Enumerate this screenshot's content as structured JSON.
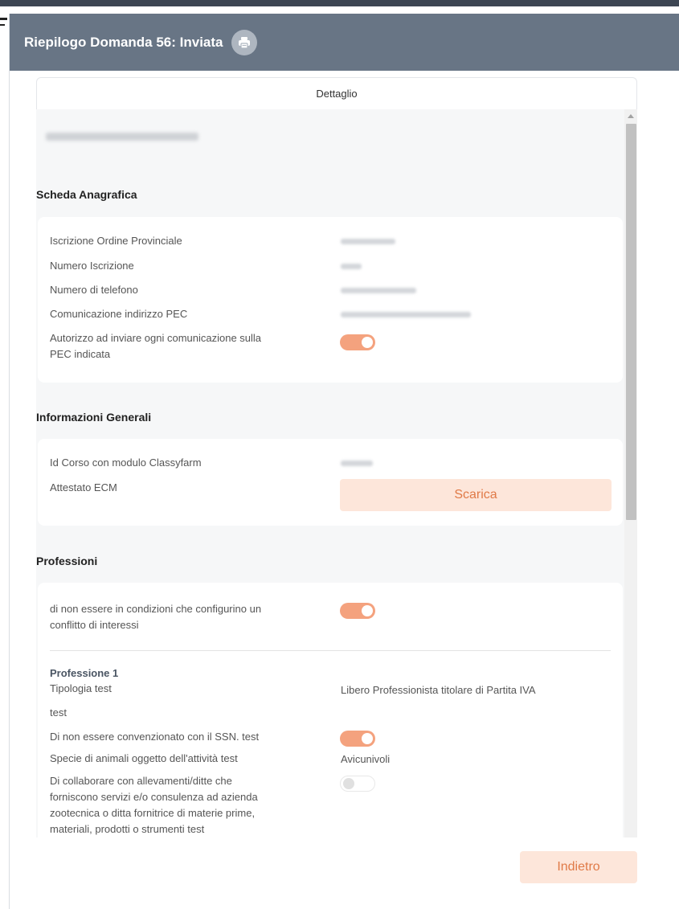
{
  "modal": {
    "title": "Riepilogo Domanda 56: Inviata",
    "print_icon": "printer-icon",
    "header_color": "#687585",
    "accent_color": "#f4a27e"
  },
  "tabs": [
    {
      "label": "Dettaglio",
      "active": true
    }
  ],
  "person": {
    "name": "[redacted]"
  },
  "scheda_anagrafica": {
    "title": "Scheda Anagrafica",
    "rows": [
      {
        "label": "Iscrizione Ordine Provinciale",
        "value": "[redacted]"
      },
      {
        "label": "Numero Iscrizione",
        "value": "[redacted]"
      },
      {
        "label": "Numero di telefono",
        "value": "[redacted]"
      },
      {
        "label": "Comunicazione indirizzo PEC",
        "value": "[redacted]"
      }
    ],
    "consent": {
      "line1": "Autorizzo ad inviare ogni comunicazione sulla",
      "line2": "PEC indicata",
      "checked": true
    }
  },
  "informazioni_generali": {
    "title": "Informazioni Generali",
    "id_corso_label": "Id Corso con modulo Classyfarm",
    "id_corso_value": "[redacted]",
    "attestato_label": "Attestato ECM",
    "download_label": "Scarica"
  },
  "professioni": {
    "title": "Professioni",
    "conflitto": {
      "line1": "di non essere in condizioni che configurino un",
      "line2": "conflitto di interessi",
      "checked": true
    },
    "professione_title": "Professione 1",
    "tipologia_label": "Tipologia test",
    "tipologia_value": "Libero Professionista titolare di Partita IVA",
    "test_label": "test",
    "ssn_label": "Di non essere convenzionato con il SSN. test",
    "ssn_checked": true,
    "specie_label": "Specie di animali oggetto dell'attività test",
    "specie_value": "Avicunivoli",
    "collabora": {
      "line1": "Di collaborare con allevamenti/ditte che",
      "line2": "forniscono servizi e/o consulenza ad azienda",
      "line3": "zootecnica o ditta fornitrice di materie prime,",
      "line4": "materiali, prodotti o strumenti test",
      "checked": false
    }
  },
  "footer": {
    "back_label": "Indietro"
  }
}
